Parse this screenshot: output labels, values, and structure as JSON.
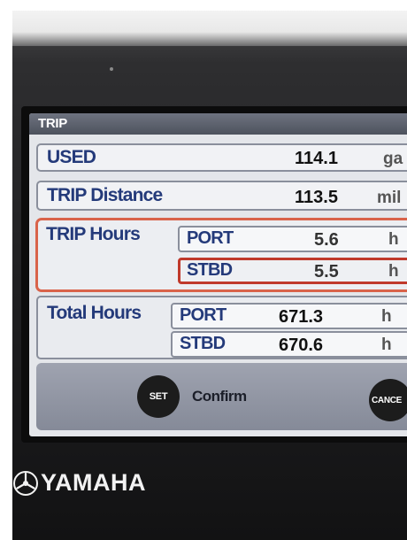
{
  "screen": {
    "title": "TRIP",
    "used": {
      "label": "USED",
      "value": "114.1",
      "unit": "ga"
    },
    "trip_distance": {
      "label": "TRIP Distance",
      "value": "113.5",
      "unit": "mil"
    },
    "trip_hours": {
      "label": "TRIP Hours",
      "port": {
        "label": "PORT",
        "value": "5.6",
        "unit": "h"
      },
      "stbd": {
        "label": "STBD",
        "value": "5.5",
        "unit": "h"
      }
    },
    "total_hours": {
      "label": "Total Hours",
      "port": {
        "label": "PORT",
        "value": "671.3",
        "unit": "h"
      },
      "stbd": {
        "label": "STBD",
        "value": "670.6",
        "unit": "h"
      }
    },
    "buttons": {
      "set": {
        "icon_text": "SET",
        "label": "Confirm"
      },
      "cancel": {
        "icon_text": "CANCE"
      }
    }
  },
  "device": {
    "brand": "YAMAHA"
  },
  "colors": {
    "label_blue": "#243a7a",
    "selection_red": "#c0392b",
    "screen_bg": "#e4e6ea",
    "title_bar": "#5c616d"
  }
}
